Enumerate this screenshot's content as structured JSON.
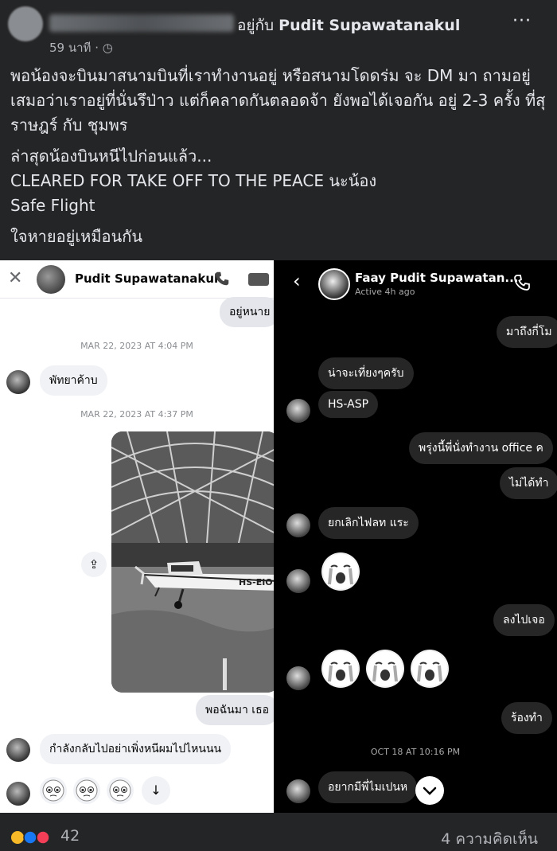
{
  "post": {
    "with_prefix": "อยู่กับ",
    "with_name": "Pudit Supawatanakul",
    "time": "59 นาที",
    "separator": "·",
    "more_label": "···",
    "paragraphs": [
      "พอน้องจะบินมาสนามบินที่เราทำงานอยู่ หรือสนามโดดร่ม จะ DM มา ถามอยู่เสมอว่าเราอยู่ที่นั่นรึป่าว แต่ก็คลาดกันตลอดจ้า ยังพอได้เจอกัน อยู่ 2-3 ครั้ง ที่สุราษฎร์ กับ ชุมพร",
      "ล่าสุดน้องบินหนีไปก่อนแล้ว...\nCLEARED FOR TAKE OFF TO THE PEACE นะน้อง\nSafe Flight",
      "ใจหายอยู่เหมือนกัน"
    ]
  },
  "left_chat": {
    "contact_name": "Pudit Supawatanakul",
    "close_icon": "close-icon",
    "msg_top_right": "อยู่หนาย",
    "ts1": "MAR 22, 2023 AT 4:04 PM",
    "msg_left_1": "พัทยาค้าบ",
    "ts2": "MAR 22, 2023 AT 4:37 PM",
    "photo_reg": "HS-EIO",
    "msg_right_2": "พอฉันมา เธอ",
    "msg_left_2": "กำลังกลับไปอย่าเพิ่งหนีผมไปไหนนน",
    "down_arrow": "↓"
  },
  "right_chat": {
    "contact_name": "Faay Pudit Supawatan...",
    "status": "Active 4h ago",
    "back_icon": "‹",
    "m1": "มาถึงกี่โม",
    "m2": "น่าจะเที่ยงๆครับ",
    "m3": "HS-ASP",
    "m4": "พรุ่งนี้พี่นั่งทำงาน office ค",
    "m5": "ไม่ได้ทำ",
    "m6": "ยกเลิกไฟลท แระ",
    "m7": "ลงไปเจอ",
    "m8": "ร้องทำ",
    "ts": "OCT 18 AT 10:16 PM",
    "m9": "อยากมีพี่ไมเปนห"
  },
  "footer": {
    "reactions_count": "42",
    "comments": "4 ความคิดเห็น"
  }
}
